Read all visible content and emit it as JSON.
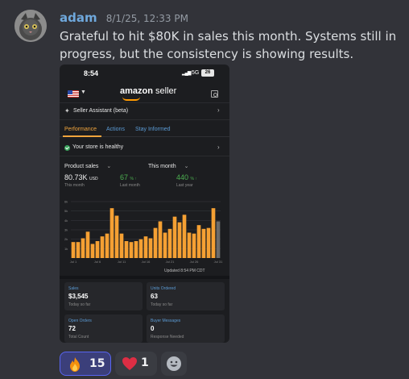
{
  "message": {
    "username": "adam",
    "timestamp": "8/1/25, 12:33 PM",
    "text": "Grateful to hit $80K in sales this month. Systems still in progress, but the consistency is showing results."
  },
  "phone": {
    "status": {
      "time": "8:54",
      "network": "5G",
      "battery": "26"
    },
    "brand": {
      "word1": "amazon",
      "word2": "seller"
    },
    "assistant_label": "Seller Assistant (beta)",
    "tabs": [
      "Performance",
      "Actions",
      "Stay Informed"
    ],
    "health_label": "Your store is healthy",
    "dropdown_left": "Product sales",
    "dropdown_right": "This month",
    "metrics": [
      {
        "value": "80.73K",
        "unit": "USD",
        "label": "This month"
      },
      {
        "value": "67",
        "unit": "% ↑",
        "label": "Last month"
      },
      {
        "value": "440",
        "unit": "% ↑",
        "label": "Last year"
      }
    ],
    "updated": "Updated 8:54 PM CDT",
    "cards": [
      {
        "title": "Sales",
        "value": "$3,545",
        "sub": "Today so far"
      },
      {
        "title": "Units Ordered",
        "value": "63",
        "sub": "Today so far"
      },
      {
        "title": "Open Orders",
        "value": "72",
        "sub": "Total Count"
      },
      {
        "title": "Buyer Messages",
        "value": "0",
        "sub": "Response Needed"
      }
    ]
  },
  "reactions": [
    {
      "emoji": "fire-emoji",
      "count": "15"
    },
    {
      "emoji": "heart-emoji",
      "count": "1"
    }
  ],
  "colors": {
    "bar": "#f5a033",
    "accent_blue": "#5b9bd5",
    "green": "#4caf50",
    "username": "#6fa8dc"
  },
  "chart_data": {
    "type": "bar",
    "ylabel": "",
    "yticks": [
      "6k",
      "5k",
      "4k",
      "3k",
      "2k",
      "1k"
    ],
    "xticks": [
      "Jul 1",
      "Jul 6",
      "Jul 11",
      "Jul 16",
      "Jul 21",
      "Jul 26",
      "Jul 31"
    ],
    "ylim": [
      0,
      6000
    ],
    "values": [
      1700,
      1700,
      2100,
      2800,
      1500,
      1800,
      2300,
      2600,
      5300,
      4500,
      2600,
      1800,
      1700,
      1800,
      2000,
      2300,
      2100,
      3200,
      3900,
      2700,
      3100,
      4400,
      3800,
      4600,
      2700,
      2600,
      3500,
      3100,
      3200,
      5300,
      3900
    ],
    "last_bar_partial": true
  }
}
